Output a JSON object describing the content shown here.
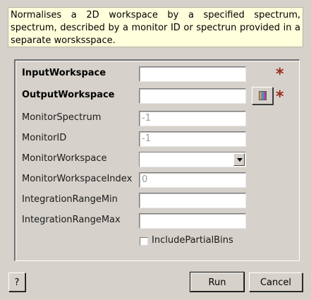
{
  "description": "Normalises a 2D workspace by a specified spectrum, spectrum, described by a monitor ID or spectrun provided in a separate worsksspace.",
  "fields": {
    "input_workspace": {
      "label": "InputWorkspace",
      "value": ""
    },
    "output_workspace": {
      "label": "OutputWorkspace",
      "value": ""
    },
    "monitor_spectrum": {
      "label": "MonitorSpectrum",
      "placeholder": "-1"
    },
    "monitor_id": {
      "label": "MonitorID",
      "placeholder": "-1"
    },
    "monitor_workspace": {
      "label": "MonitorWorkspace",
      "selected": ""
    },
    "monitor_workspace_index": {
      "label": "MonitorWorkspaceIndex",
      "placeholder": "0"
    },
    "integration_range_min": {
      "label": "IntegrationRangeMin",
      "value": ""
    },
    "integration_range_max": {
      "label": "IntegrationRangeMax",
      "value": ""
    }
  },
  "include_partial_bins": {
    "label": "IncludePartialBins",
    "checked": false
  },
  "required_marker": "*",
  "buttons": {
    "help": "?",
    "run": "Run",
    "cancel": "Cancel"
  },
  "icons": {
    "browse": "workspace-browse-icon",
    "required": "required-star-icon",
    "dropdown": "chevron-down-icon"
  },
  "colors": {
    "required_star": "#9b2b1d",
    "description_bg": "#ffffdc",
    "window_bg": "#d6d2cb"
  }
}
